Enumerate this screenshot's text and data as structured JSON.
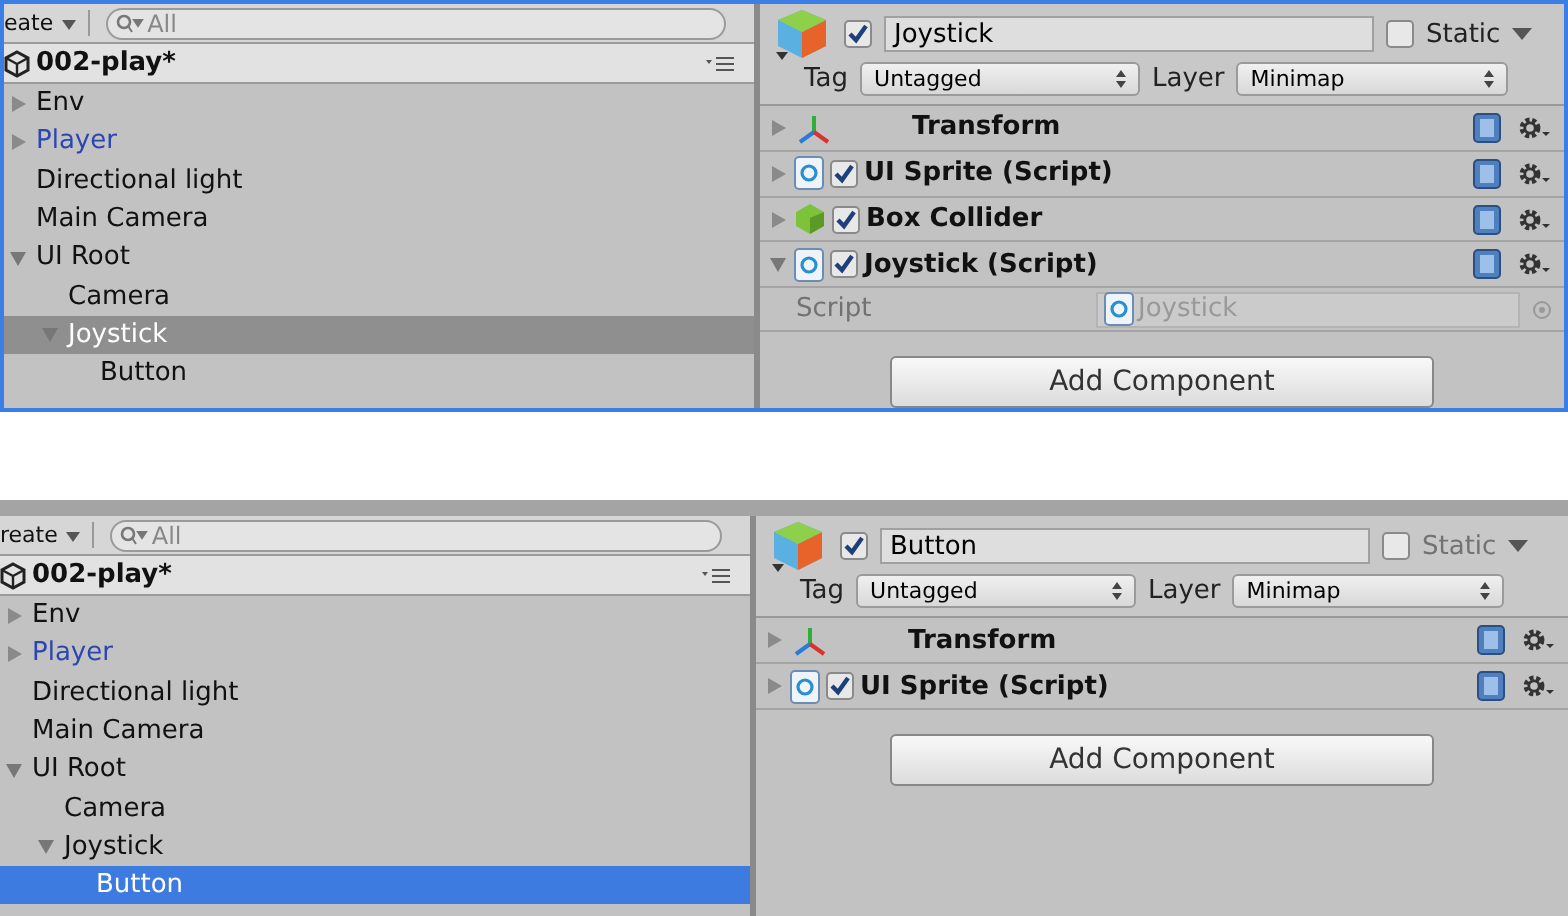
{
  "snapshots": [
    {
      "framed": true,
      "selection_focused": false,
      "create_label": "eate",
      "search_placeholder": "All",
      "scene": "002-play*",
      "hierarchy": [
        {
          "label": "Env",
          "expanded": false,
          "selected": false,
          "prefab": false
        },
        {
          "label": "Player",
          "expanded": false,
          "selected": false,
          "prefab": true
        },
        {
          "label": "Directional light",
          "selected": false,
          "prefab": false
        },
        {
          "label": "Main Camera",
          "selected": false,
          "prefab": false
        },
        {
          "label": "UI Root",
          "expanded": true,
          "selected": false,
          "prefab": false,
          "children": [
            {
              "label": "Camera",
              "selected": false,
              "prefab": false
            },
            {
              "label": "Joystick",
              "expanded": true,
              "selected": true,
              "prefab": false,
              "children": [
                {
                  "label": "Button",
                  "selected": false,
                  "prefab": false
                }
              ]
            }
          ]
        }
      ],
      "inspector": {
        "active": true,
        "name": "Joystick",
        "static": false,
        "static_label": "Static",
        "tag_label": "Tag",
        "tag": "Untagged",
        "layer_label": "Layer",
        "layer": "Minimap",
        "components": [
          {
            "kind": "transform",
            "title": "Transform",
            "expanded": false
          },
          {
            "kind": "script",
            "title": "UI Sprite (Script)",
            "enabled": true,
            "expanded": false
          },
          {
            "kind": "collider",
            "title": "Box Collider",
            "enabled": true,
            "expanded": false
          },
          {
            "kind": "script",
            "title": "Joystick (Script)",
            "enabled": true,
            "expanded": true,
            "fields": [
              {
                "label": "Script",
                "value": "Joystick"
              }
            ]
          }
        ],
        "add_button": "Add Component"
      }
    },
    {
      "framed": false,
      "selection_focused": true,
      "create_label": "reate",
      "search_placeholder": "All",
      "scene": "002-play*",
      "hierarchy": [
        {
          "label": "Env",
          "expanded": false,
          "selected": false,
          "prefab": false
        },
        {
          "label": "Player",
          "expanded": false,
          "selected": false,
          "prefab": true
        },
        {
          "label": "Directional light",
          "selected": false,
          "prefab": false
        },
        {
          "label": "Main Camera",
          "selected": false,
          "prefab": false
        },
        {
          "label": "UI Root",
          "expanded": true,
          "selected": false,
          "prefab": false,
          "children": [
            {
              "label": "Camera",
              "selected": false,
              "prefab": false
            },
            {
              "label": "Joystick",
              "expanded": true,
              "selected": false,
              "prefab": false,
              "children": [
                {
                  "label": "Button",
                  "selected": true,
                  "prefab": false
                }
              ]
            }
          ]
        }
      ],
      "inspector": {
        "active": true,
        "name": "Button",
        "static": false,
        "static_label": "Static",
        "tag_label": "Tag",
        "tag": "Untagged",
        "layer_label": "Layer",
        "layer": "Minimap",
        "components": [
          {
            "kind": "transform",
            "title": "Transform",
            "expanded": false
          },
          {
            "kind": "script",
            "title": "UI Sprite (Script)",
            "enabled": true,
            "expanded": false
          }
        ],
        "add_button": "Add Component"
      }
    }
  ]
}
